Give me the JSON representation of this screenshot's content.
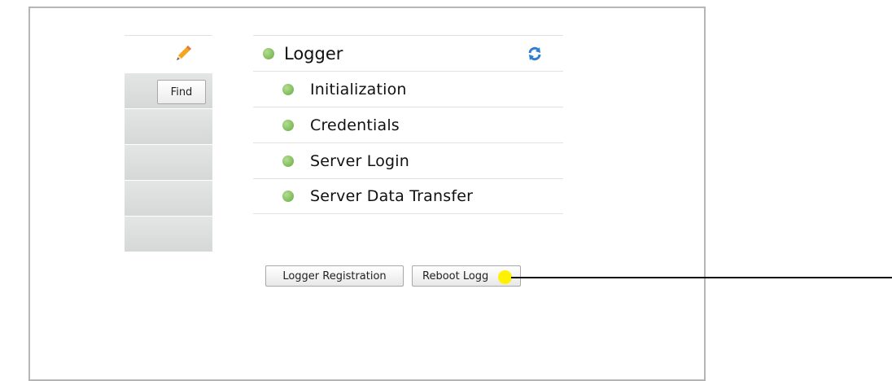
{
  "left_panel": {
    "edit_icon": "pencil-icon",
    "find_label": "Find"
  },
  "logger": {
    "title": "Logger",
    "status_color": "#7cbb58",
    "refresh_icon": "refresh-icon",
    "items": [
      {
        "label": "Initialization"
      },
      {
        "label": "Credentials"
      },
      {
        "label": "Server Login"
      },
      {
        "label": "Server Data Transfer"
      }
    ]
  },
  "actions": {
    "registration_label": "Logger Registration",
    "reboot_label": "Reboot Logg"
  },
  "annotation": {
    "highlight_color": "#fff200"
  }
}
